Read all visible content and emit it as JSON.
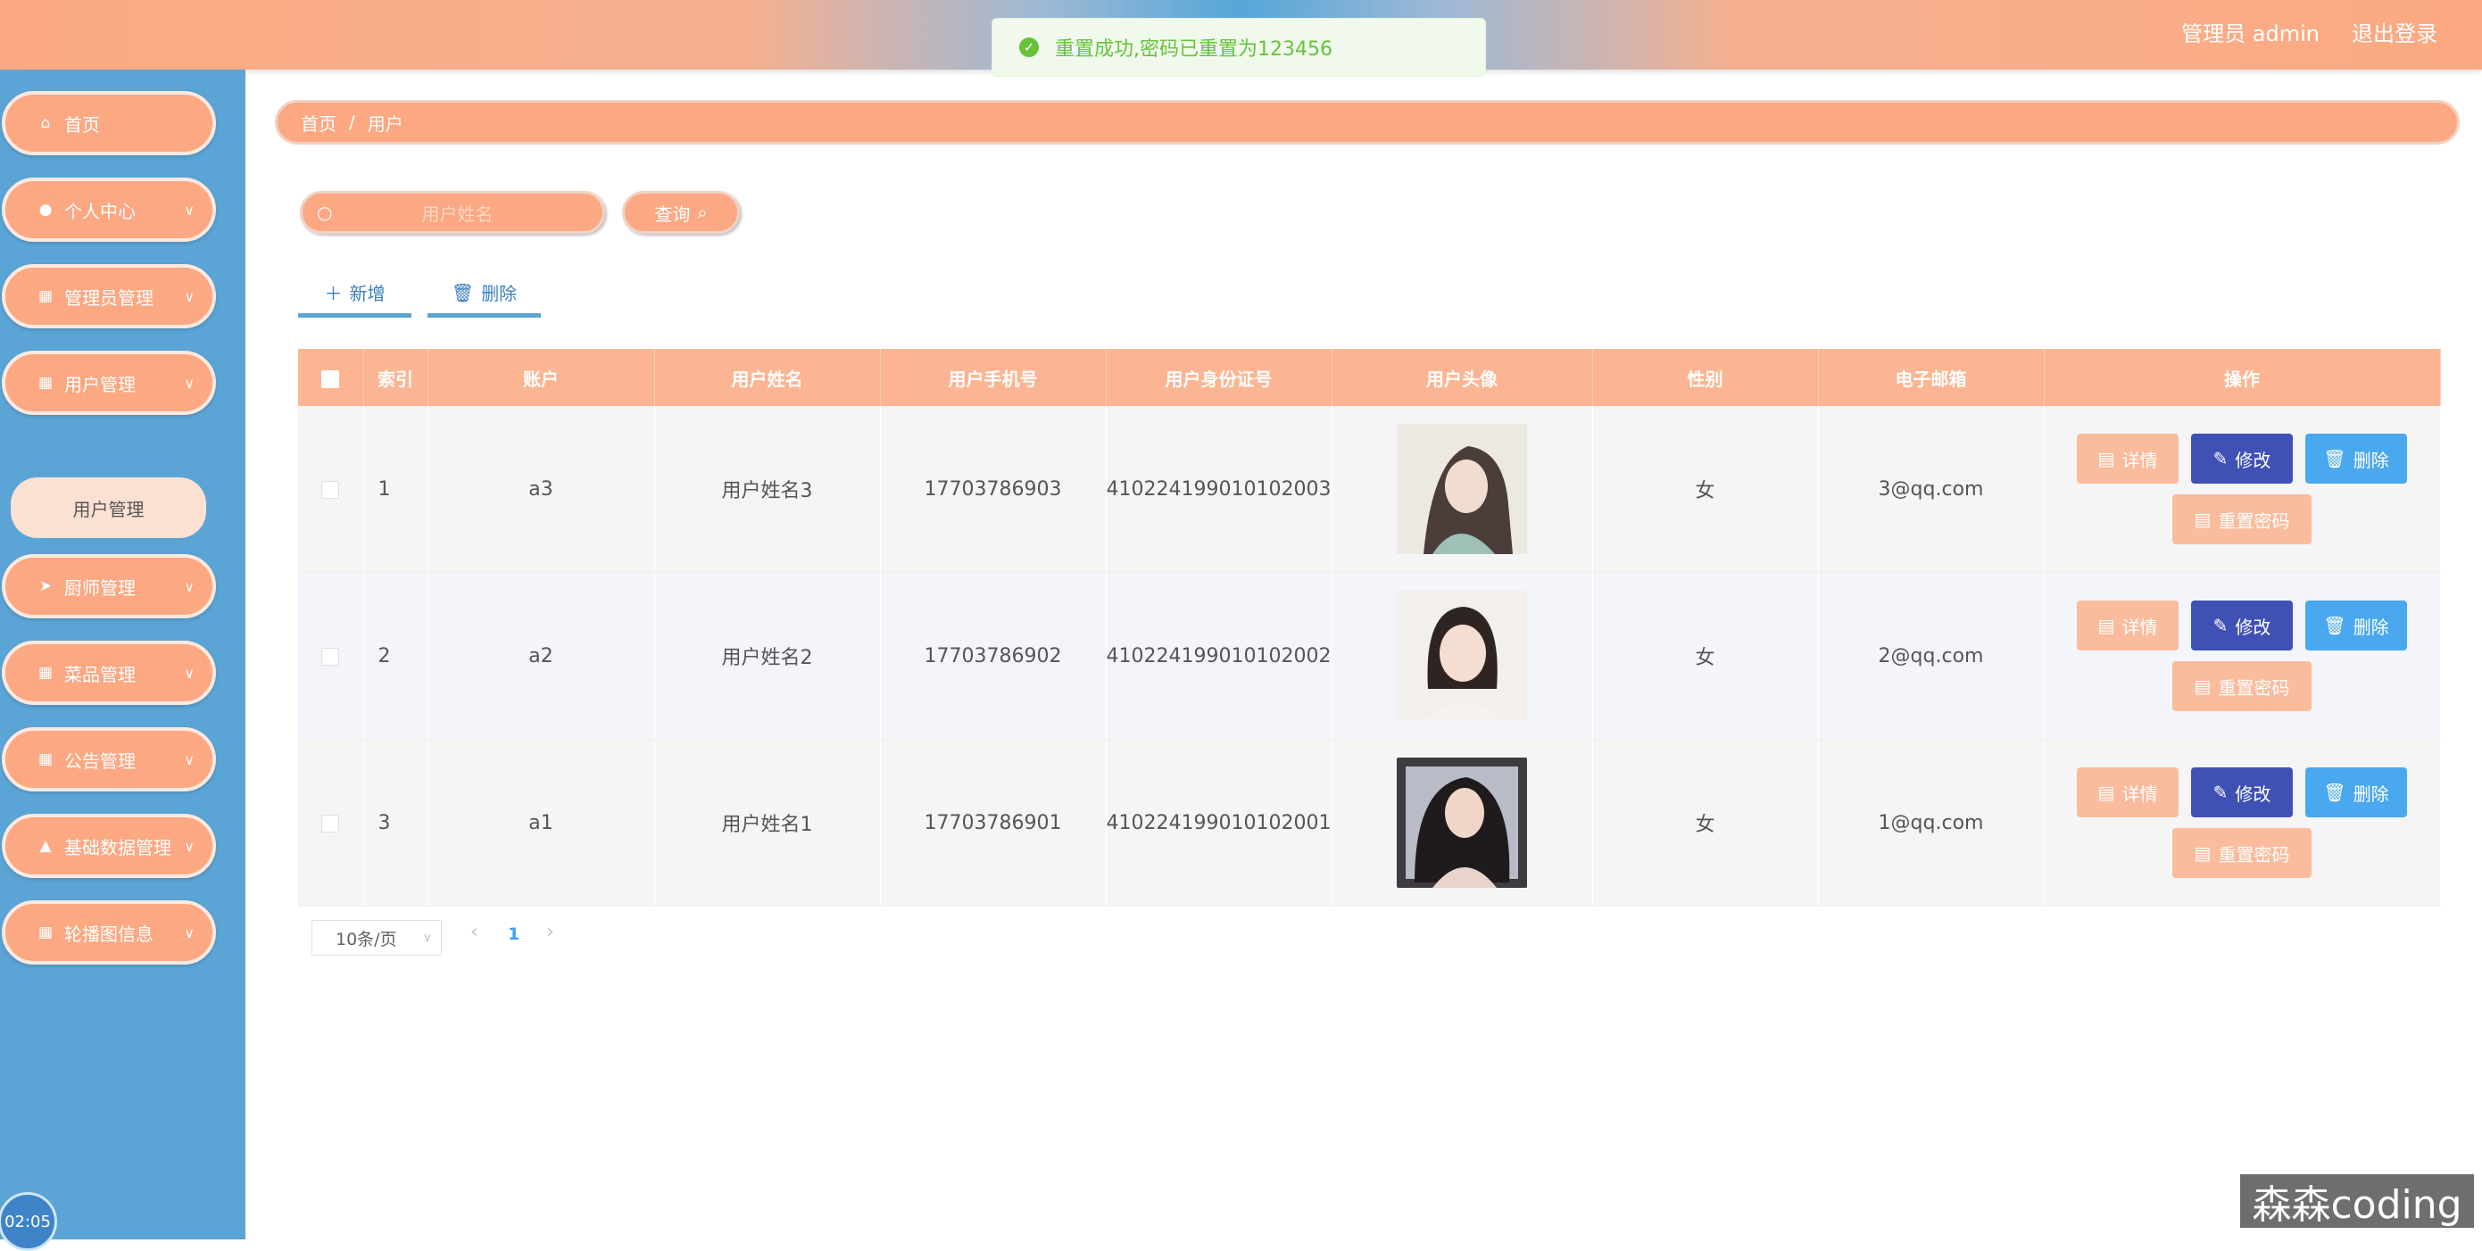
{
  "header": {
    "admin_label": "管理员 admin",
    "logout_label": "退出登录",
    "toast_message": "重置成功,密码已重置为123456"
  },
  "sidebar": {
    "items": [
      {
        "label": "首页",
        "icon": "home-icon"
      },
      {
        "label": "个人中心",
        "icon": "user-icon"
      },
      {
        "label": "管理员管理",
        "icon": "grid-icon"
      },
      {
        "label": "用户管理",
        "icon": "grid-icon"
      },
      {
        "label": "厨师管理",
        "icon": "send-icon"
      },
      {
        "label": "菜品管理",
        "icon": "grid-icon"
      },
      {
        "label": "公告管理",
        "icon": "grid-icon"
      },
      {
        "label": "基础数据管理",
        "icon": "thumb-icon"
      },
      {
        "label": "轮播图信息",
        "icon": "grid-icon"
      }
    ],
    "submenu_label": "用户管理",
    "clock": "02:05"
  },
  "breadcrumb": {
    "home": "首页",
    "separator": "/",
    "current": "用户"
  },
  "search": {
    "placeholder": "用户姓名",
    "button_label": "查询"
  },
  "actions": {
    "add_label": "新增",
    "delete_label": "删除"
  },
  "table": {
    "columns": [
      "索引",
      "账户",
      "用户姓名",
      "用户手机号",
      "用户身份证号",
      "用户头像",
      "性别",
      "电子邮箱",
      "操作"
    ],
    "rows": [
      {
        "index": "1",
        "account": "a3",
        "name": "用户姓名3",
        "phone": "17703786903",
        "id_card": "410224199010102003",
        "gender": "女",
        "email": "3@qq.com"
      },
      {
        "index": "2",
        "account": "a2",
        "name": "用户姓名2",
        "phone": "17703786902",
        "id_card": "410224199010102002",
        "gender": "女",
        "email": "2@qq.com"
      },
      {
        "index": "3",
        "account": "a1",
        "name": "用户姓名1",
        "phone": "17703786901",
        "id_card": "410224199010102001",
        "gender": "女",
        "email": "1@qq.com"
      }
    ],
    "op_labels": {
      "detail": "详情",
      "edit": "修改",
      "delete": "删除",
      "reset": "重置密码"
    }
  },
  "pagination": {
    "page_size": "10条/页",
    "current_page": "1"
  },
  "watermark": "森森coding",
  "colors": {
    "accent": "#fba883",
    "sidebar": "#5ba5d6",
    "edit": "#3f51b5",
    "delete": "#4aa8ee",
    "success": "#67c23a"
  }
}
